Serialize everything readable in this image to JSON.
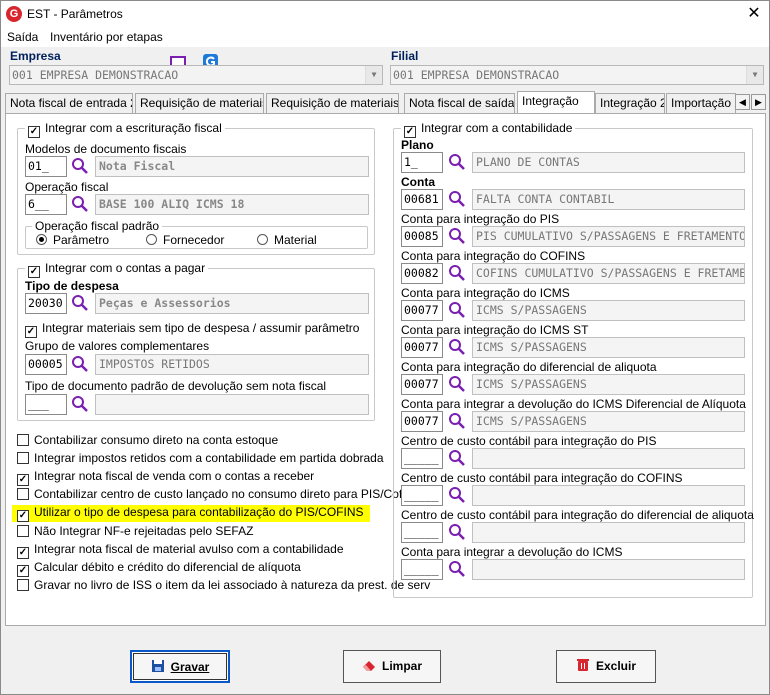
{
  "window": {
    "title": "EST - Parâmetros",
    "close_glyph": "✕",
    "app_icon_letter": "G"
  },
  "menu": {
    "items": [
      "Saída",
      "Inventário por etapas"
    ],
    "icons": [
      "monitor-icon",
      "app-g-icon"
    ]
  },
  "empresa": {
    "label": "Empresa",
    "value": "001 EMPRESA DEMONSTRACAO"
  },
  "filial": {
    "label": "Filial",
    "value": "001 EMPRESA DEMONSTRACAO"
  },
  "tabs": {
    "items": [
      "Nota fiscal de entrada 2",
      "Requisição de materiais",
      "Requisição de materiais 2",
      "Nota fiscal de saída",
      "Integração",
      "Integração 2",
      "Importação XML"
    ],
    "active": "Integração",
    "prev_glyph": "◀",
    "next_glyph": "▶"
  },
  "fiscal": {
    "title": "Integrar com a escrituração fiscal",
    "checked": true,
    "modelos_label": "Modelos de documento fiscais",
    "modelos_code": "01_",
    "modelos_desc": "Nota Fiscal",
    "operacao_label": "Operação fiscal",
    "operacao_code": "6__",
    "operacao_desc": "BASE 100 ALIQ ICMS 18",
    "padrao_title": "Operação fiscal padrão",
    "radios": [
      "Parâmetro",
      "Fornecedor",
      "Material"
    ],
    "radio_selected": "Parâmetro"
  },
  "pagar": {
    "title": "Integrar com o contas a pagar",
    "checked": true,
    "tipo_label": "Tipo de despesa",
    "tipo_code": "20030",
    "tipo_desc": "Peças e Assessorios",
    "sem_tipo_label": "Integrar materiais sem tipo de despesa / assumir parâmetro",
    "sem_tipo_checked": true,
    "grupo_label": "Grupo de valores complementares",
    "grupo_code": "00005",
    "grupo_desc": "IMPOSTOS RETIDOS",
    "devol_label": "Tipo de documento padrão de devolução sem nota fiscal",
    "devol_code": "___",
    "devol_desc": ""
  },
  "options": [
    {
      "label": "Contabilizar consumo direto na conta estoque",
      "checked": false
    },
    {
      "label": "Integrar impostos retidos com a contabilidade em partida dobrada",
      "checked": false
    },
    {
      "label": "Integrar nota fiscal de venda com o contas a receber",
      "checked": true
    },
    {
      "label": "Contabilizar centro de custo lançado no consumo direto para PIS/Cofins",
      "checked": false
    },
    {
      "label": "Utilizar o tipo de despesa para contabilização do PIS/COFINS",
      "checked": true,
      "highlight": true
    },
    {
      "label": "Não Integrar NF-e rejeitadas pelo SEFAZ",
      "checked": false
    },
    {
      "label": "Integrar nota fiscal de material avulso com a contabilidade",
      "checked": true
    },
    {
      "label": "Calcular débito e crédito do diferencial de alíquota",
      "checked": true
    },
    {
      "label": "Gravar no livro de ISS o item da lei associado à natureza da prest. de serv",
      "checked": false
    }
  ],
  "contab": {
    "title": "Integrar com a contabilidade",
    "checked": true,
    "fields": [
      {
        "label": "Plano",
        "bold": true,
        "code": "1_",
        "desc": "PLANO DE CONTAS"
      },
      {
        "label": "Conta",
        "bold": true,
        "code": "00681",
        "desc": "FALTA CONTA CONTABIL"
      },
      {
        "label": "Conta para integração do PIS",
        "bold": false,
        "code": "00085",
        "desc": "PIS CUMULATIVO S/PASSAGENS E FRETAMENTO"
      },
      {
        "label": "Conta para integração do COFINS",
        "bold": false,
        "code": "00082",
        "desc": "COFINS CUMULATIVO S/PASSAGENS E FRETAMENTO"
      },
      {
        "label": "Conta para integração do ICMS",
        "bold": false,
        "code": "00077",
        "desc": "ICMS S/PASSAGENS"
      },
      {
        "label": "Conta para integração do ICMS ST",
        "bold": false,
        "code": "00077",
        "desc": "ICMS S/PASSAGENS"
      },
      {
        "label": "Conta para integração do diferencial de aliquota",
        "bold": false,
        "code": "00077",
        "desc": "ICMS S/PASSAGENS"
      },
      {
        "label": "Conta para integrar a devolução do ICMS Diferencial de Alíquota",
        "bold": false,
        "code": "00077",
        "desc": "ICMS S/PASSAGENS"
      },
      {
        "label": "Centro de custo contábil para integração do PIS",
        "bold": false,
        "code": "_____",
        "desc": ""
      },
      {
        "label": "Centro de custo contábil para integração do COFINS",
        "bold": false,
        "code": "_____",
        "desc": ""
      },
      {
        "label": "Centro de custo contábil para integração do diferencial de aliquota",
        "bold": false,
        "code": "_____",
        "desc": ""
      },
      {
        "label": "Conta para integrar a devolução do ICMS",
        "bold": false,
        "code": "_____",
        "desc": ""
      }
    ]
  },
  "buttons": {
    "gravar": "Gravar",
    "limpar": "Limpar",
    "excluir": "Excluir"
  },
  "colors": {
    "highlight": "#ffff00",
    "brand_red": "#d8262e",
    "group_label": "#00205c",
    "default_button_border": "#0a58c8"
  }
}
